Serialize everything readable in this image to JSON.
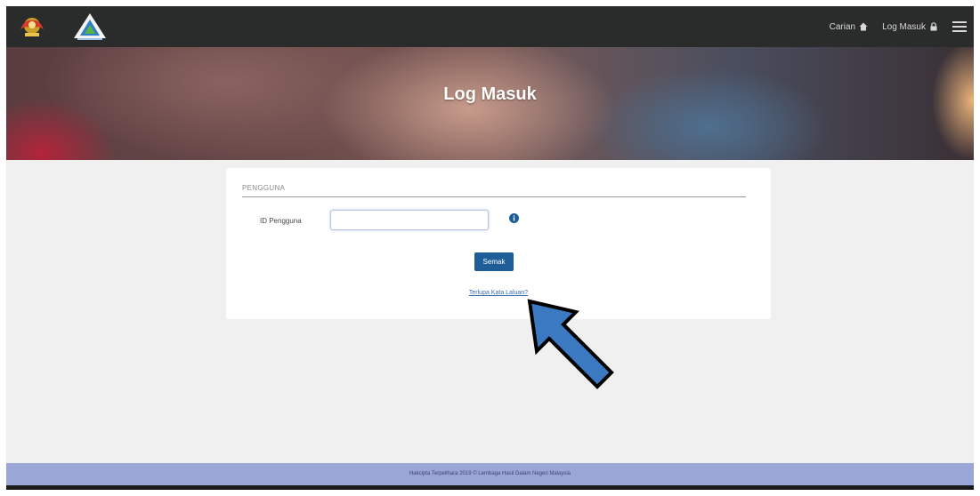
{
  "navbar": {
    "links": [
      {
        "label": "Carian",
        "icon": "home-icon"
      },
      {
        "label": "Log Masuk",
        "icon": "lock-icon"
      }
    ],
    "menu_icon": "hamburger-icon"
  },
  "banner": {
    "title": "Log Masuk"
  },
  "login": {
    "section_label": "PENGGUNA",
    "id_label": "ID Pengguna",
    "id_value": "",
    "submit_label": "Semak",
    "forgot_link": "Terlupa Kata Laluan?"
  },
  "footer": {
    "text": "Hakcipta Terpelihara 2019 © Lembaga Hasil Dalam Negeri Malaysia"
  },
  "colors": {
    "navbar": "#2a2b2b",
    "primary_button": "#1f5d99",
    "footer": "#9aa7d6",
    "annotation_arrow": "#3b7ac0"
  }
}
